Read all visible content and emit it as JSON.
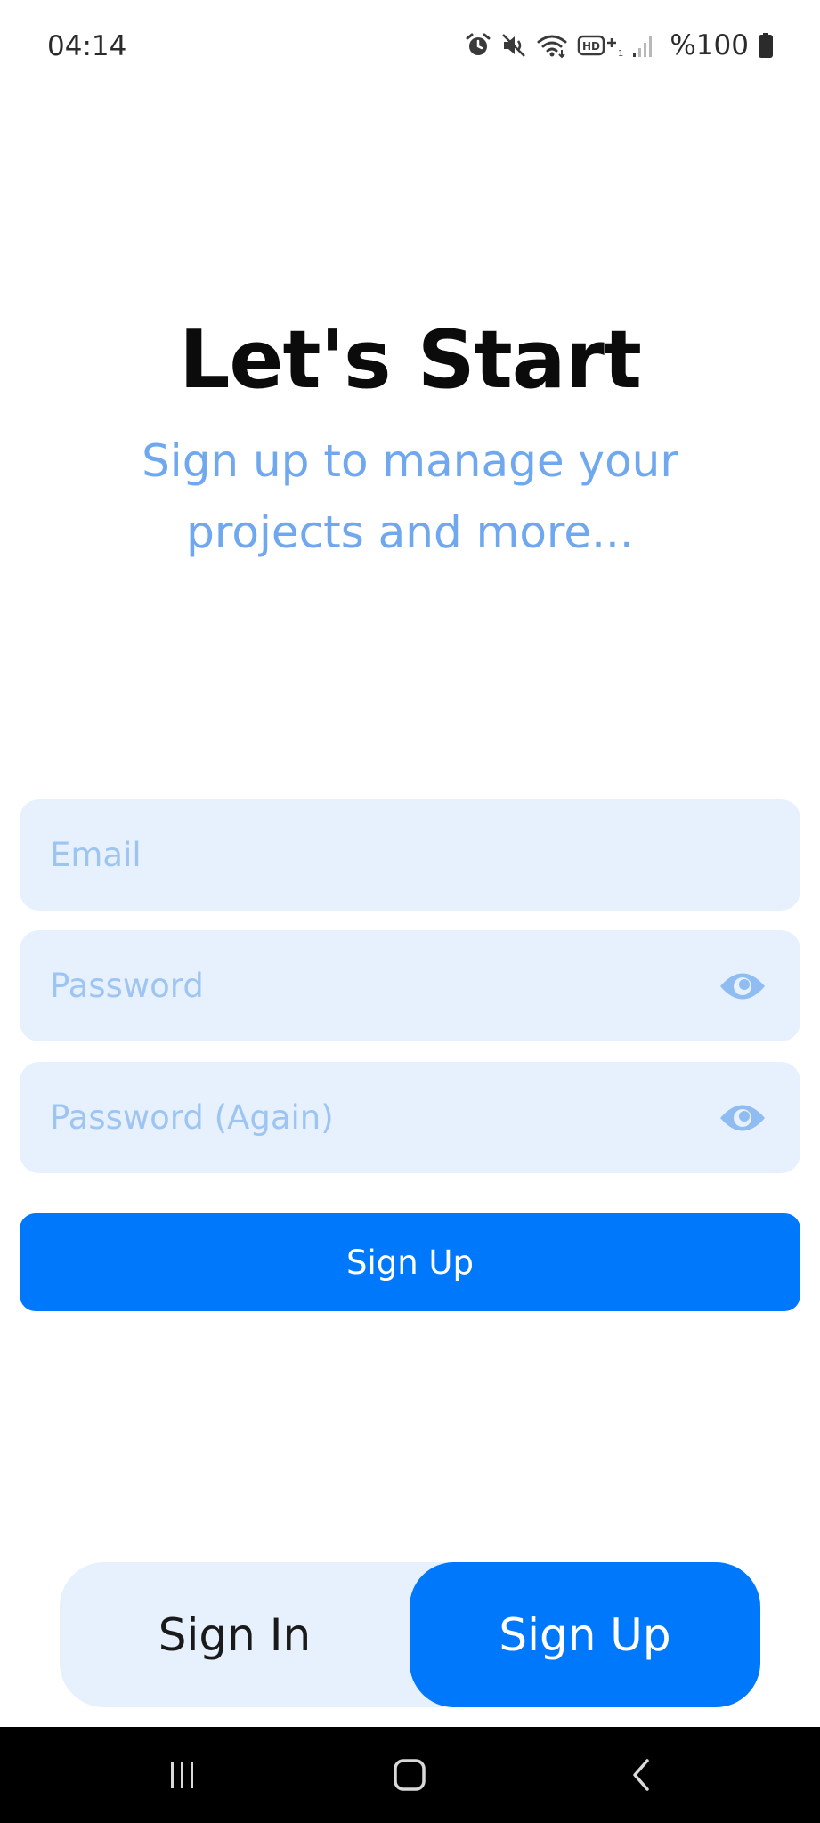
{
  "status_bar": {
    "time": "04:14",
    "battery_label": "%100",
    "icons": [
      "alarm-icon",
      "mute-icon",
      "wifi-icon",
      "hd-voice-icon",
      "signal-icon",
      "battery-icon"
    ]
  },
  "header": {
    "title": "Let's Start",
    "subtitle": "Sign up to manage your projects and more..."
  },
  "form": {
    "email": {
      "placeholder": "Email",
      "value": ""
    },
    "password": {
      "placeholder": "Password",
      "value": ""
    },
    "password_again": {
      "placeholder": "Password (Again)",
      "value": ""
    },
    "submit_label": "Sign Up"
  },
  "auth_switch": {
    "sign_in_label": "Sign In",
    "sign_up_label": "Sign Up",
    "selected": "Sign Up"
  },
  "colors": {
    "accent": "#0078fc",
    "field_background": "#e6f1fd",
    "subtitle": "#6fa8ee",
    "placeholder": "#9ec5f2"
  }
}
